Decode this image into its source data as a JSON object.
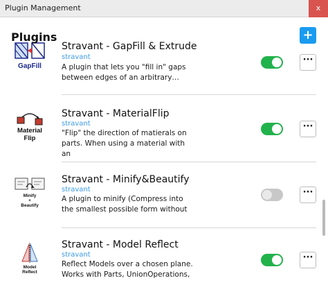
{
  "window": {
    "title": "Plugin Management",
    "close_label": "x"
  },
  "header": {
    "title": "Plugins",
    "add_label": "+"
  },
  "plugins": [
    {
      "name": "Stravant - GapFill & Extrude",
      "author": "stravant",
      "description": "A plugin that lets you \"fill in\" gaps between edges of an arbitrary…",
      "enabled": true,
      "thumb_label": "GapFill",
      "more_label": "···"
    },
    {
      "name": "Stravant - MaterialFlip",
      "author": "stravant",
      "description": "\"Flip\" the direction of matierals on parts. When using a material with an",
      "enabled": true,
      "thumb_label_1": "Material",
      "thumb_label_2": "Flip",
      "more_label": "···"
    },
    {
      "name": "Stravant - Minify&Beautify",
      "author": "stravant",
      "description": "A plugin to minify (Compress into the smallest possible form without",
      "enabled": false,
      "thumb_label_1": "Minify",
      "thumb_label_2": "+",
      "thumb_label_3": "Beautify",
      "more_label": "···"
    },
    {
      "name": "Stravant - Model Reflect",
      "author": "stravant",
      "description": "Reflect Models over a chosen plane. Works with Parts, UnionOperations,",
      "enabled": true,
      "thumb_label_1": "Model",
      "thumb_label_2": "Reflect",
      "more_label": "···"
    }
  ],
  "colors": {
    "accent": "#1a9bf0",
    "toggle_on": "#22b24c",
    "toggle_off": "#c8c8c8",
    "author": "#3a9ae8"
  }
}
